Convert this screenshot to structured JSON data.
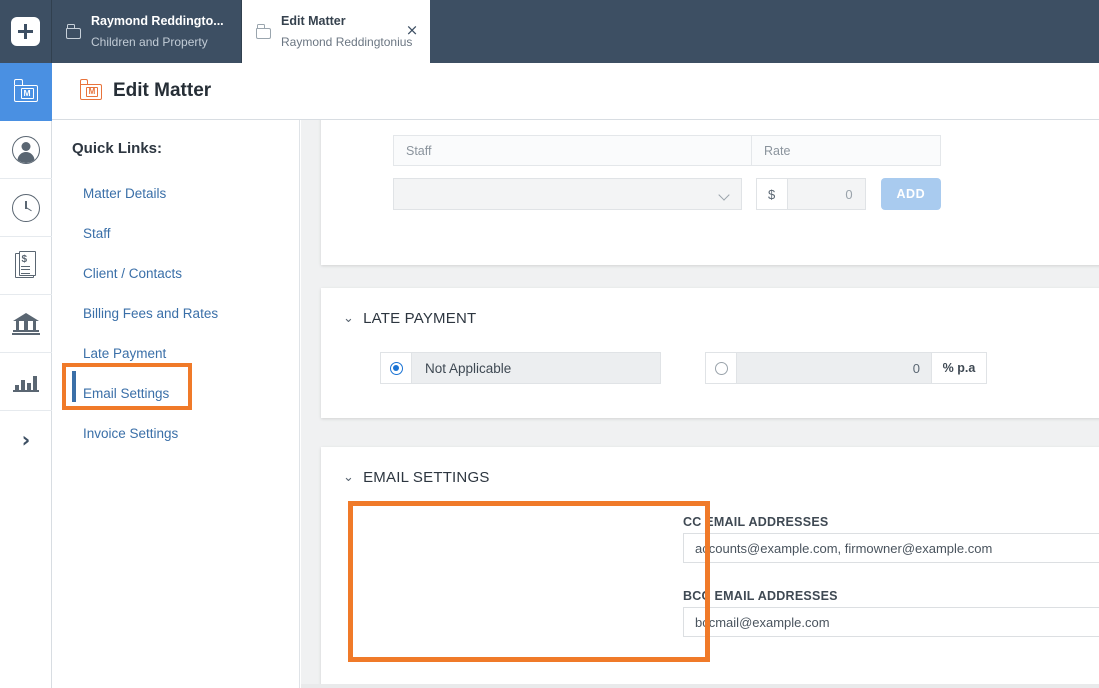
{
  "topbar": {
    "new_button_icon": "plus-icon",
    "tabs": [
      {
        "icon": "folder-icon",
        "title": "Raymond Reddingto...",
        "subtitle": "Children and Property",
        "active": false
      },
      {
        "icon": "folder-icon",
        "title": "Edit Matter",
        "subtitle": "Raymond Reddingtonius",
        "active": true,
        "close_label": "×"
      }
    ]
  },
  "rail": {
    "items": [
      {
        "icon": "matter-folder-icon",
        "letter": "M",
        "active": true
      },
      {
        "icon": "person-icon",
        "active": false
      },
      {
        "icon": "clock-icon",
        "active": false
      },
      {
        "icon": "invoice-document-icon",
        "symbol": "$",
        "active": false
      },
      {
        "icon": "bank-icon",
        "active": false
      },
      {
        "icon": "bar-chart-icon",
        "active": false
      },
      {
        "icon": "chevron-right-icon",
        "glyph": "›",
        "active": false
      }
    ]
  },
  "header": {
    "icon": "matter-folder-icon",
    "icon_letter": "M",
    "title": "Edit Matter"
  },
  "quick_links": {
    "heading": "Quick Links:",
    "items": [
      {
        "label": "Matter Details",
        "highlighted": false
      },
      {
        "label": "Staff",
        "highlighted": false
      },
      {
        "label": "Client / Contacts",
        "highlighted": false
      },
      {
        "label": "Billing Fees and Rates",
        "highlighted": false
      },
      {
        "label": "Late Payment",
        "highlighted": false
      },
      {
        "label": "Email Settings",
        "highlighted": true
      },
      {
        "label": "Invoice Settings",
        "highlighted": false
      }
    ]
  },
  "staff_rates": {
    "columns": {
      "staff": "Staff",
      "rate": "Rate"
    },
    "staff_select_value": "",
    "currency_symbol": "$",
    "rate_value": "0",
    "add_label": "ADD"
  },
  "late_payment": {
    "section_title": "LATE PAYMENT",
    "chevron": "⌄",
    "not_applicable_label": "Not Applicable",
    "not_applicable_selected": true,
    "rate_value": "0",
    "rate_unit": "% p.a",
    "rate_selected": false
  },
  "email_settings": {
    "section_title": "EMAIL SETTINGS",
    "chevron": "⌄",
    "cc_label": "CC EMAIL ADDRESSES",
    "cc_value": "accounts@example.com, firmowner@example.com",
    "bcc_label": "BCC EMAIL ADDRESSES",
    "bcc_value": "bccmail@example.com"
  },
  "colors": {
    "topbar": "#3d4f63",
    "rail_active": "#4a90e2",
    "accent_orange": "#f07a29",
    "link_blue": "#3a6fa8",
    "add_button": "#a9cbef",
    "radio_blue": "#1a73d4"
  }
}
